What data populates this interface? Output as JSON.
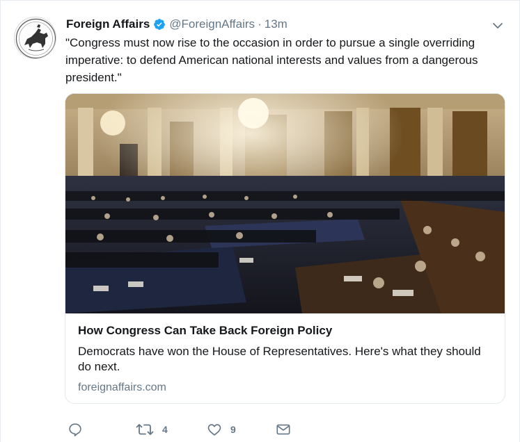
{
  "tweet": {
    "author_name": "Foreign Affairs",
    "handle": "@ForeignAffairs",
    "separator": "·",
    "timestamp": "13m",
    "text": "\"Congress must now rise to the occasion in order to pursue a single overriding imperative: to defend American national interests and values from a dangerous president.\""
  },
  "card": {
    "title": "How Congress Can Take Back Foreign Policy",
    "description": "Democrats have won the House of Representatives. Here's what they should do next.",
    "domain": "foreignaffairs.com"
  },
  "actions": {
    "reply_count": "",
    "retweet_count": "4",
    "like_count": "9"
  },
  "icons": {
    "verified": "verified-badge-icon",
    "caret": "chevron-down-icon",
    "reply": "reply-icon",
    "retweet": "retweet-icon",
    "like": "heart-icon",
    "dm": "envelope-icon"
  },
  "colors": {
    "verified_blue": "#1da1f2",
    "secondary_text": "#657786",
    "card_border": "#e1e8ed"
  }
}
